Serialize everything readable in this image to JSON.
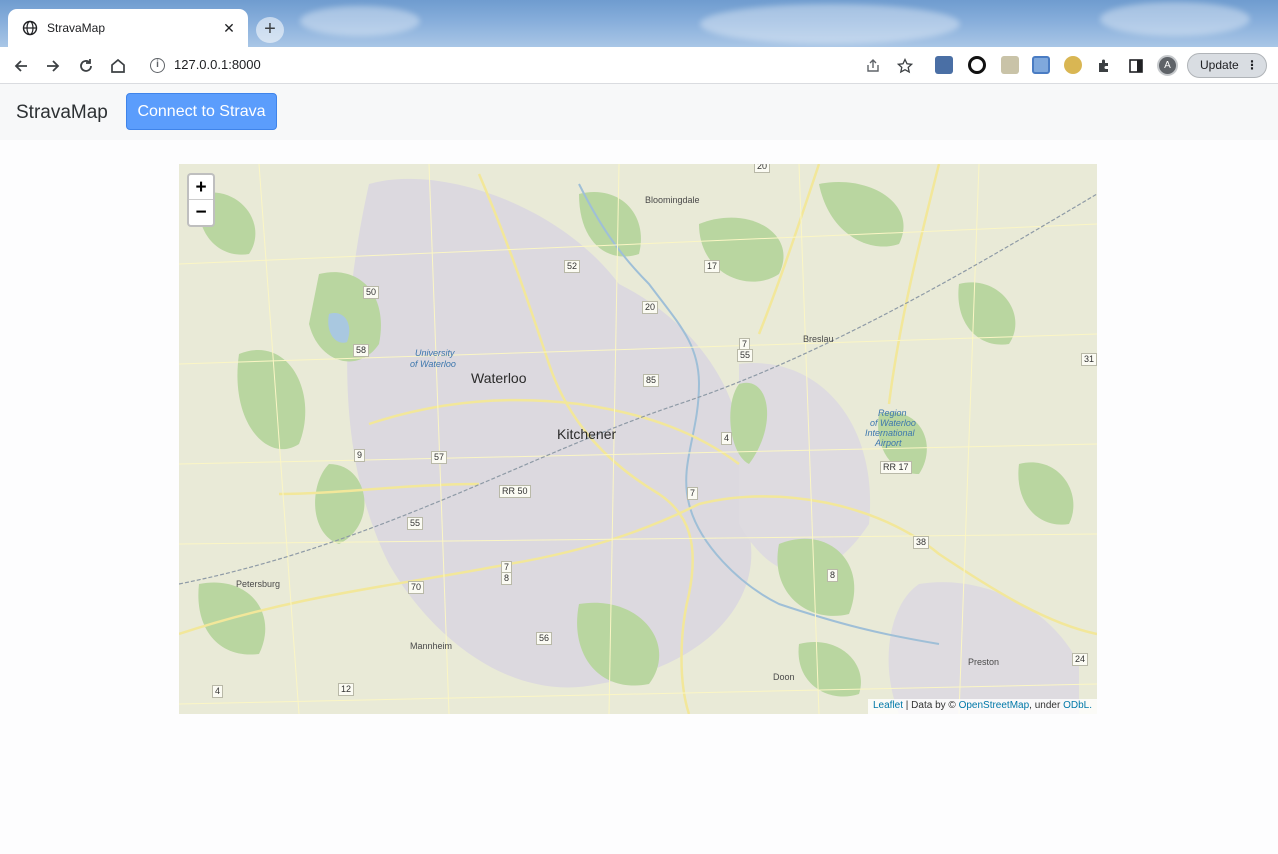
{
  "browser": {
    "tab_title": "StravaMap",
    "tab_close": "✕",
    "new_tab": "+",
    "url": "127.0.0.1:8000",
    "url_info": "i",
    "update_label": "Update",
    "update_menu": "⋮",
    "profile_initial": "A"
  },
  "navbar": {
    "brand": "StravaMap",
    "connect_label": "Connect to Strava"
  },
  "map": {
    "zoom_in": "+",
    "zoom_out": "−",
    "attribution": {
      "leaflet": "Leaflet",
      "separator": " | Data by © ",
      "osm": "OpenStreetMap",
      "under": ", under ",
      "odbl": "ODbL."
    },
    "places": {
      "waterloo": "Waterloo",
      "kitchener": "Kitchener",
      "bloomingdale": "Bloomingdale",
      "breslau": "Breslau",
      "petersburg": "Petersburg",
      "mannheim": "Mannheim",
      "doon": "Doon",
      "preston": "Preston",
      "university_1": "University",
      "university_2": "of Waterloo",
      "airport_1": "Region",
      "airport_2": "of Waterloo",
      "airport_3": "International",
      "airport_4": "Airport"
    },
    "shields": {
      "s20a": "20",
      "s52": "52",
      "s17": "17",
      "s50": "50",
      "s20b": "20",
      "s58": "58",
      "s7a": "7",
      "s55a": "55",
      "s85": "85",
      "s4": "4",
      "s9": "9",
      "s57": "57",
      "rr50": "RR 50",
      "s7b": "7",
      "s55b": "55",
      "rr17": "RR 17",
      "s38": "38",
      "s7c": "7",
      "s8a": "8",
      "s70": "70",
      "s8b": "8",
      "s56": "56",
      "s4b": "4",
      "s12": "12",
      "s24": "24",
      "s31": "31"
    }
  }
}
